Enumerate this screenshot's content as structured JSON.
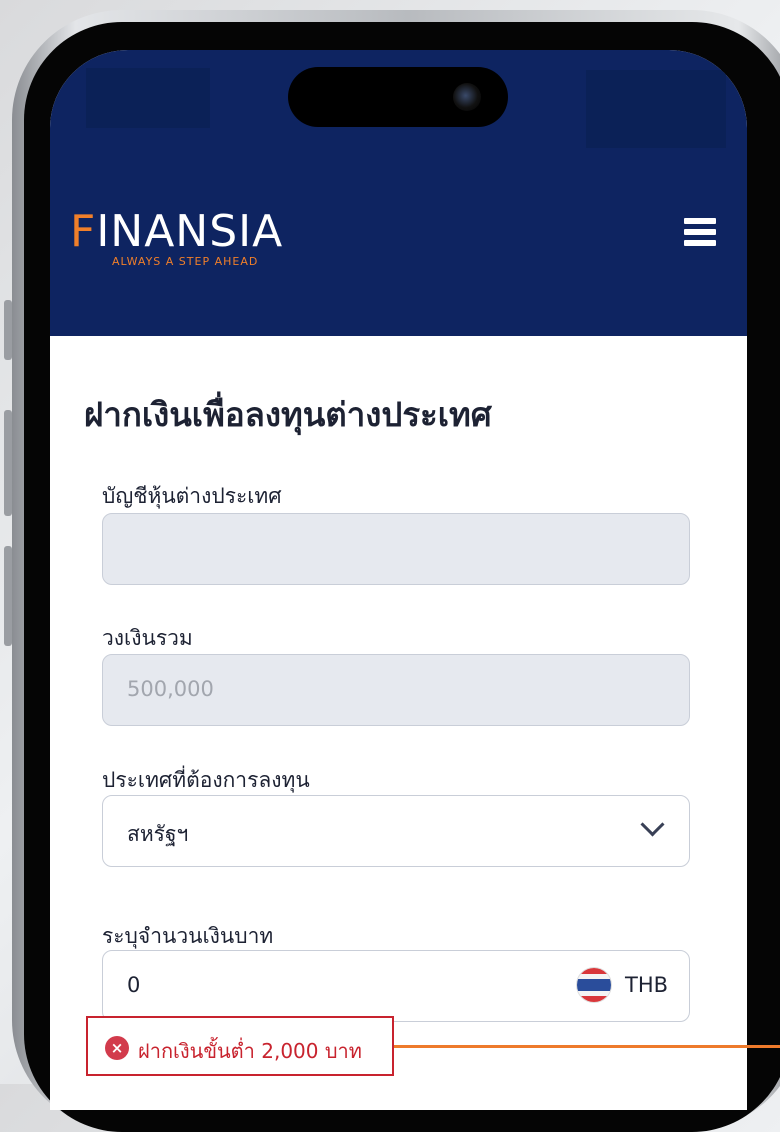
{
  "app": {
    "logo_text": "FINANSIA",
    "logo_letter_first": "F",
    "logo_letters_rest": "INANSIA",
    "tagline": "ALWAYS A STEP AHEAD",
    "menu_icon": "hamburger-icon"
  },
  "page": {
    "title": "ฝากเงินเพื่อลงทุนต่างประเทศ"
  },
  "form": {
    "account": {
      "label": "บัญชีหุ้นต่างประเทศ",
      "value": ""
    },
    "credit_limit": {
      "label": "วงเงินรวม",
      "value": "500,000"
    },
    "country": {
      "label": "ประเทศที่ต้องการลงทุน",
      "selected": "สหรัฐฯ",
      "icon": "chevron-down-icon"
    },
    "amount": {
      "label": "ระบุจำนวนเงินบาท",
      "value": "0",
      "currency": "THB",
      "flag_icon": "thailand-flag-icon"
    }
  },
  "error": {
    "icon": "error-x-icon",
    "message": "ฝากเงินขั้นต่ำ 2,000 บาท"
  },
  "colors": {
    "header_bg": "#0e2461",
    "brand_orange": "#f07f2a",
    "error_red": "#c8232e",
    "callout": "#ee7a2b"
  }
}
